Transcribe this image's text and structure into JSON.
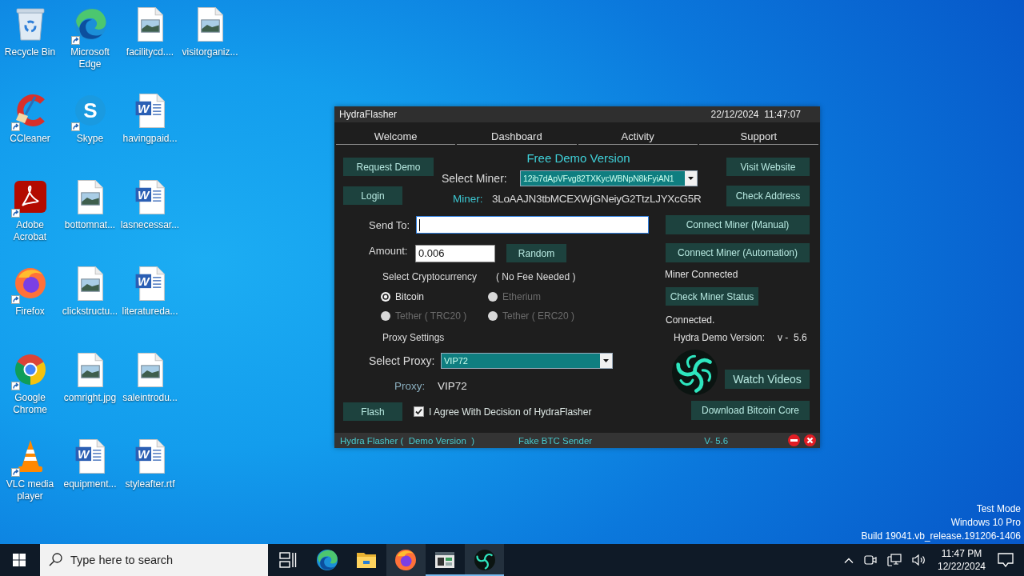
{
  "desktop": {
    "icons": [
      {
        "label": "Recycle Bin",
        "kind": "recycle-bin",
        "shortcut": false
      },
      {
        "label": "CCleaner",
        "kind": "ccleaner",
        "shortcut": true
      },
      {
        "label": "Adobe Acrobat",
        "kind": "acrobat",
        "shortcut": true
      },
      {
        "label": "Firefox",
        "kind": "firefox",
        "shortcut": true
      },
      {
        "label": "Google Chrome",
        "kind": "chrome",
        "shortcut": true
      },
      {
        "label": "VLC media player",
        "kind": "vlc",
        "shortcut": true
      },
      {
        "label": "Microsoft Edge",
        "kind": "edge",
        "shortcut": true
      },
      {
        "label": "Skype",
        "kind": "skype",
        "letter": "S",
        "shortcut": true
      },
      {
        "label": "bottomnat...",
        "kind": "image-file",
        "shortcut": false
      },
      {
        "label": "clickstructu...",
        "kind": "image-file",
        "shortcut": false
      },
      {
        "label": "comright.jpg",
        "kind": "image-file",
        "shortcut": false
      },
      {
        "label": "equipment...",
        "kind": "word-file",
        "letter": "W",
        "shortcut": false
      },
      {
        "label": "facilitycd....",
        "kind": "image-file",
        "shortcut": false
      },
      {
        "label": "havingpaid...",
        "kind": "word-file",
        "letter": "W",
        "shortcut": false
      },
      {
        "label": "lasnecessar...",
        "kind": "word-file",
        "letter": "W",
        "shortcut": false
      },
      {
        "label": "literatureda...",
        "kind": "word-file",
        "letter": "W",
        "shortcut": false
      },
      {
        "label": "saleintrodu...",
        "kind": "image-file",
        "shortcut": false
      },
      {
        "label": "styleafter.rtf",
        "kind": "word-file",
        "letter": "W",
        "shortcut": false
      },
      {
        "label": "visitorganiz...",
        "kind": "image-file",
        "shortcut": false
      }
    ],
    "system_notice": [
      "Test Mode",
      "Windows 10 Pro",
      "Build 19041.vb_release.191206-1406"
    ]
  },
  "window": {
    "title": "HydraFlasher",
    "clock": "22/12/2024  11:47:07",
    "tabs": [
      "Welcome",
      "Dashboard",
      "Activity",
      "Support"
    ],
    "left_buttons": [
      "Request Demo",
      "Login"
    ],
    "banner": "Free Demo Version",
    "miner_select": {
      "label": "Select Miner:",
      "value": "12ib7dApVFvg82TXKycWBNpN8kFyiAN1"
    },
    "miner": {
      "label": "Miner:",
      "value": "3LoAAJN3tbMCEXWjGNeiyG2TtzLJYXcG5R"
    },
    "right_buttons": [
      "Visit Website",
      "Check Address"
    ],
    "send_to": {
      "label": "Send To:",
      "focused": true
    },
    "amount": {
      "label": "Amount:",
      "value": "0.006"
    },
    "random_button": "Random",
    "crypto": {
      "label": "Select Cryptocurrency",
      "note": "( No Fee Needed )",
      "options": [
        {
          "label": "Bitcoin",
          "selected": true,
          "disabled": false
        },
        {
          "label": "Etherium",
          "selected": false,
          "disabled": true
        },
        {
          "label": "Tether ( TRC20 )",
          "selected": false,
          "disabled": true
        },
        {
          "label": "Tether ( ERC20 )",
          "selected": false,
          "disabled": true
        }
      ]
    },
    "proxy": {
      "heading": "Proxy Settings",
      "select_label": "Select Proxy:",
      "select_value": "VIP72",
      "label": "Proxy:",
      "value": "VIP72"
    },
    "flash_button": "Flash",
    "agree": {
      "label": "I Agree With Decision of HydraFlasher",
      "checked": true
    },
    "connect_buttons": [
      "Connect Miner (Manual)",
      "Connect Miner (Automation)"
    ],
    "miner_status": "Miner Connected",
    "status_button": "Check Miner Status",
    "connection": "Connected.",
    "version": {
      "label": "Hydra Demo Version:",
      "value": "v -  5.6"
    },
    "watch_button": "Watch Videos",
    "download_button": "Download Bitcoin Core",
    "status_bar": {
      "left": "Hydra Flasher (  Demo Version  )",
      "center": "Fake BTC Sender",
      "version": "V- 5.6"
    }
  },
  "taskbar": {
    "search": {
      "placeholder": "Type here to search"
    },
    "apps": [
      {
        "kind": "task-view",
        "running": false,
        "highlighted": false
      },
      {
        "kind": "edge",
        "running": false,
        "highlighted": false
      },
      {
        "kind": "explorer",
        "running": false,
        "highlighted": false
      },
      {
        "kind": "firefox",
        "running": false,
        "highlighted": true
      },
      {
        "kind": "app-window",
        "running": true,
        "highlighted": false
      },
      {
        "kind": "hydra",
        "running": true,
        "highlighted": true
      }
    ],
    "tray": {
      "time": "11:47 PM",
      "date": "12/22/2024"
    }
  }
}
